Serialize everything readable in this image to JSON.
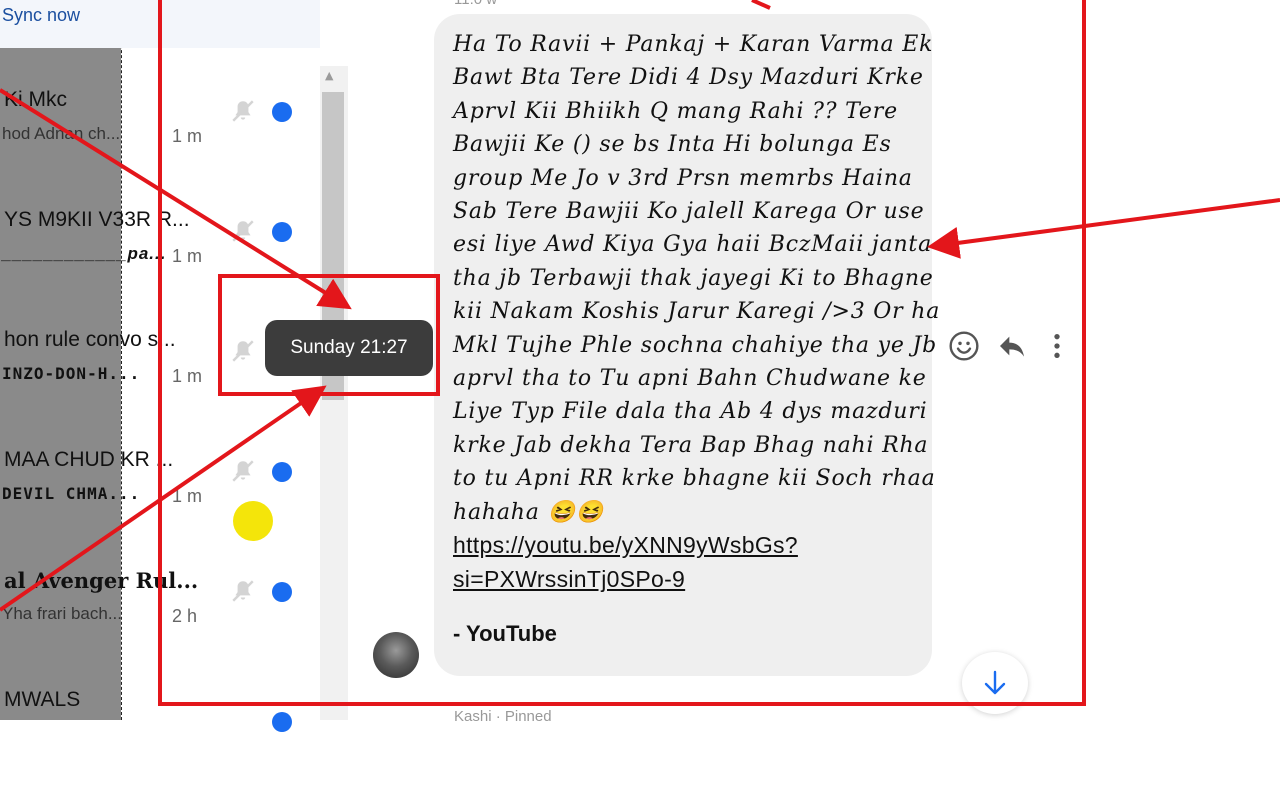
{
  "sidebar": {
    "sync_label": "Sync now",
    "chats": [
      {
        "name": "Ki Mkc",
        "preview": "hod Adnan ch...",
        "time": "1 m",
        "style": "normal"
      },
      {
        "name": "YS M9KII V33R R...",
        "preview": "____________pa...",
        "time": "1 m",
        "style": "bold"
      },
      {
        "name": "hon rule convo s...",
        "preview": "INZO-DON-H...",
        "time": "1 m",
        "style": "caps"
      },
      {
        "name": "MAA CHUD KR ...",
        "preview": "DEVIL CHMA...",
        "time": "1 m",
        "style": "caps"
      },
      {
        "name": "al Avenger Rul...",
        "preview": "Yha frari bach...",
        "time": "2 h",
        "style": "normal"
      },
      {
        "name": "MWALS",
        "preview": "",
        "time": "",
        "style": "normal"
      }
    ]
  },
  "tooltip": {
    "text": "Sunday 21:27"
  },
  "conversation": {
    "top_clipped": "11:0 w",
    "message_lines": [
      "Ha To Ravii + Pankaj + Karan Varma Ek",
      "Bawt Bta Tere Didi 4 Dsy Mazduri Krke",
      "Aprvl Kii Bhiikh Q mang Rahi ?? Tere",
      "Bawjii Ke () se bs Inta Hi bolunga Es",
      "group Me Jo v 3rd Prsn memrbs Haina",
      "Sab Tere Bawjii Ko jalell Karega Or use",
      "esi liye Awd Kiya Gya haii BczMaii janta",
      "tha jb Terbawji thak jayegi Ki to Bhagne",
      "kii Nakam Koshis Jarur Karegi />3 Or ha",
      "Mkl Tujhe Phle sochna chahiye tha ye Jb",
      "aprvl tha to Tu apni Bahn Chudwane ke",
      "Liye Typ File dala tha Ab 4 dys mazduri",
      "krke Jab dekha Tera Bap Bhag nahi Rha",
      "to tu Apni RR krke bhagne kii Soch rhaa",
      "hahaha 😆😆"
    ],
    "link_lines": [
      "https://youtu.be/yXNN9yWsbGs?",
      "si=PXWrssinTj0SPo-9"
    ],
    "link_source": "- YouTube",
    "bottom_clipped": "Kashi · Pinned",
    "colors": {
      "bubble": "#efefef",
      "accent": "#1a6cf0",
      "annotation": "#e3161b"
    }
  },
  "icons": {
    "emoji": "smiley-icon",
    "reply": "reply-icon",
    "more": "more-vertical-icon",
    "mute": "bell-off-icon",
    "scroll_down": "arrow-down-icon"
  }
}
